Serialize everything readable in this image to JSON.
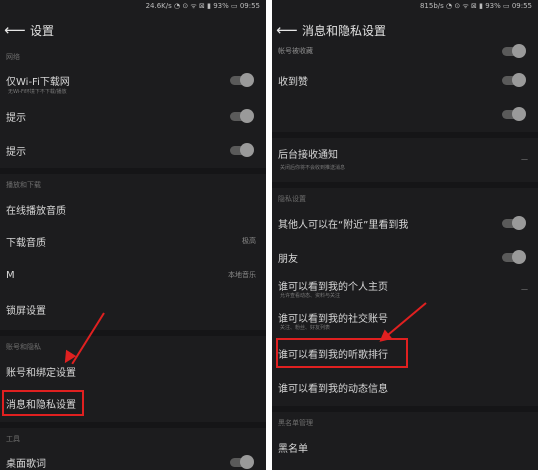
{
  "left": {
    "status": "24.6K/s ◔ ⊙ ᯤ ⊠ ▮ 93% ▭ 09:55",
    "title": "设置",
    "rows": [
      {
        "label": "仅Wi-Fi下载网",
        "sub": "无Wi-Fi环境下不下载/播放",
        "header": "网络"
      },
      {
        "label": "提示"
      },
      {
        "label": "提示"
      },
      {
        "label": "在线播放音质",
        "header": "播放和下载"
      },
      {
        "label": "下载音质",
        "value": "极高"
      },
      {
        "label": "M",
        "value": "本地音乐"
      },
      {
        "label": "锁屏设置"
      },
      {
        "label": "账号和绑定设置",
        "header": "账号和隐私"
      },
      {
        "label": "消息和隐私设置"
      },
      {
        "label": "桌面歌词",
        "header": "工具"
      }
    ],
    "highlight": "消息和隐私设置"
  },
  "right": {
    "status": "815b/s ◔ ⊙ ᯤ ⊠ ▮ 93% ▭ 09:55",
    "title": "消息和隐私设置",
    "rows": [
      {
        "label": "帐号被收藏"
      },
      {
        "label": "收到赞"
      },
      {
        "label": ""
      },
      {
        "label": "后台接收通知",
        "sub": "关闭后你将不会收到推送消息",
        "value": "—"
      },
      {
        "label": "其他人可以在“附近”里看到我",
        "header": "隐私设置"
      },
      {
        "label": "朋友"
      },
      {
        "label": "谁可以看到我的个人主页",
        "sub": "允许查看动态、资料与关注"
      },
      {
        "label": "谁可以看到我的社交账号",
        "sub": "关注、粉丝、好友列表"
      },
      {
        "label": "谁可以看到我的听歌排行"
      },
      {
        "label": "谁可以看到我的动态信息"
      },
      {
        "label": "黑名单",
        "header": "黑名单管理"
      }
    ],
    "highlight": "谁可以看到我的听歌排行"
  }
}
